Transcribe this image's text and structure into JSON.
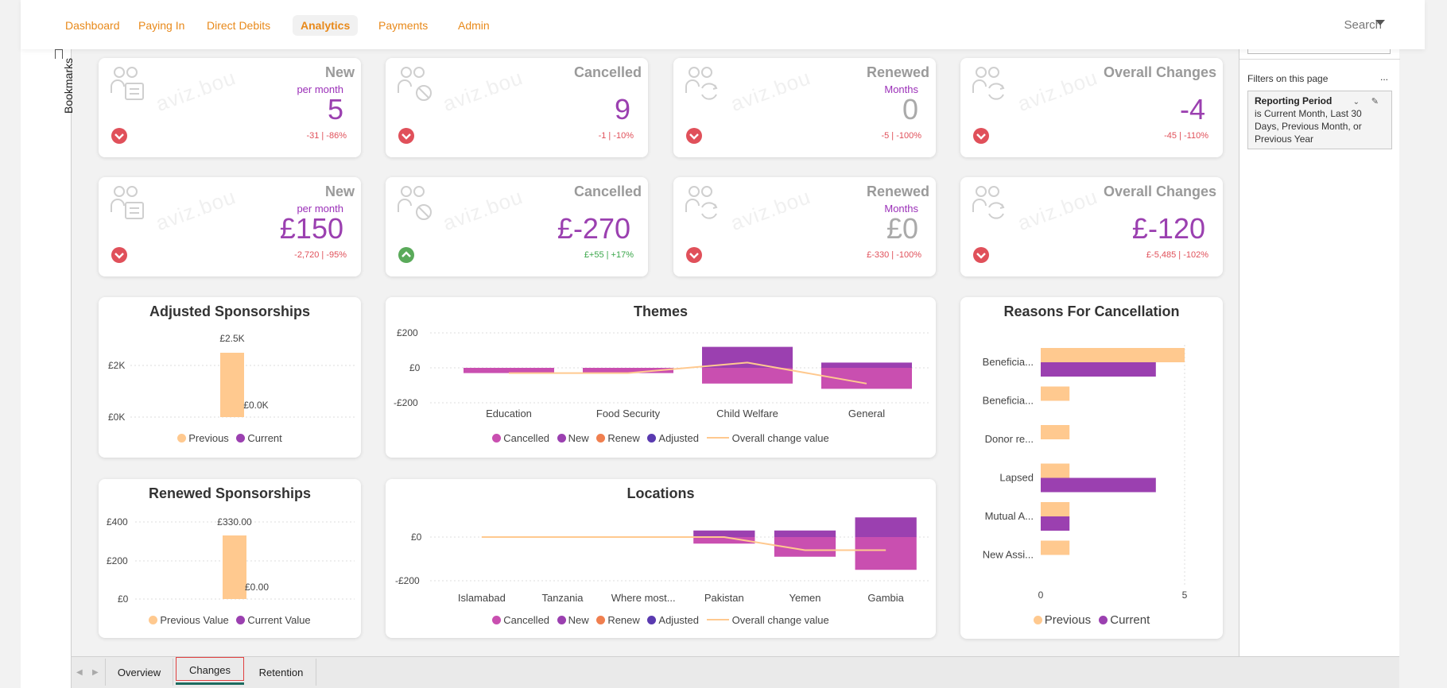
{
  "nav": {
    "items": [
      "Dashboard",
      "Paying In",
      "Direct Debits",
      "Analytics",
      "Payments",
      "Admin"
    ],
    "active": "Analytics",
    "search_label": "Search"
  },
  "bookmarks": {
    "label": "Bookmarks"
  },
  "filters": {
    "title": "Filters on this page",
    "more": "...",
    "card_title": "Reporting Period",
    "card_desc": "is Current Month, Last 30 Days, Previous Month, or Previous Year"
  },
  "kpi_row1": [
    {
      "title": "New",
      "sub": "per month",
      "value": "5",
      "delta": "-31  |  -86%",
      "trend": "down"
    },
    {
      "title": "Cancelled",
      "sub": "",
      "value": "9",
      "delta": "-1  |  -10%",
      "trend": "down"
    },
    {
      "title": "Renewed",
      "sub": "Months",
      "value": "0",
      "delta": "-5  |  -100%",
      "trend": "down",
      "grey": true
    },
    {
      "title": "Overall Changes",
      "sub": "",
      "value": "-4",
      "delta": "-45  |  -110%",
      "trend": "down"
    }
  ],
  "kpi_row2": [
    {
      "title": "New",
      "sub": "per month",
      "value": "£150",
      "delta": "-2,720  |  -95%",
      "trend": "down"
    },
    {
      "title": "Cancelled",
      "sub": "",
      "value": "£-270",
      "delta": "£+55  |  +17%",
      "trend": "up"
    },
    {
      "title": "Renewed",
      "sub": "Months",
      "value": "£0",
      "delta": "£-330  |  -100%",
      "trend": "down",
      "grey": true
    },
    {
      "title": "Overall Changes",
      "sub": "",
      "value": "£-120",
      "delta": "£-5,485  |  -102%",
      "trend": "down"
    }
  ],
  "watermark": "aviz.bou",
  "colors": {
    "previous": "#ffc98f",
    "current": "#9b40b0",
    "cancelled": "#c94fb0",
    "new": "#9b40b0",
    "renew": "#f07f4f",
    "adjusted": "#5a3ab0",
    "line": "#ffc98f",
    "down": "#e0505a",
    "up": "#5aaa5a"
  },
  "charts": {
    "adjusted": {
      "title": "Adjusted Sponsorships",
      "legend": [
        "Previous",
        "Current"
      ],
      "ticks": [
        "£2K",
        "£0K"
      ],
      "labels": [
        "£2.5K",
        "£0.0K"
      ]
    },
    "renewed": {
      "title": "Renewed Sponsorships",
      "legend": [
        "Previous Value",
        "Current Value"
      ],
      "ticks": [
        "£400",
        "£200",
        "£0"
      ],
      "labels": [
        "£330.00",
        "£0.00"
      ]
    },
    "themes": {
      "title": "Themes",
      "ticks": [
        "£200",
        "£0",
        "-£200"
      ],
      "categories": [
        "Education",
        "Food Security",
        "Child Welfare",
        "General"
      ],
      "legend": [
        "Cancelled",
        "New",
        "Renew",
        "Adjusted",
        "Overall change value"
      ]
    },
    "locations": {
      "title": "Locations",
      "ticks": [
        "£0",
        "-£200"
      ],
      "categories": [
        "Islamabad",
        "Tanzania",
        "Where most...",
        "Pakistan",
        "Yemen",
        "Gambia"
      ],
      "legend": [
        "Cancelled",
        "New",
        "Renew",
        "Adjusted",
        "Overall change value"
      ]
    },
    "reasons": {
      "title": "Reasons For Cancellation",
      "categories": [
        "Beneficia...",
        "Beneficia...",
        "Donor re...",
        "Lapsed",
        "Mutual A...",
        "New Assi..."
      ],
      "ticks": [
        "0",
        "5"
      ],
      "legend": [
        "Previous",
        "Current"
      ]
    }
  },
  "chart_data": [
    {
      "type": "bar",
      "title": "Adjusted Sponsorships",
      "categories": [
        "Previous",
        "Current"
      ],
      "values": [
        2500,
        0
      ],
      "data_labels": [
        "£2.5K",
        "£0.0K"
      ],
      "ylim": [
        0,
        2500
      ]
    },
    {
      "type": "bar",
      "title": "Renewed Sponsorships",
      "categories": [
        "Previous Value",
        "Current Value"
      ],
      "values": [
        330,
        0
      ],
      "data_labels": [
        "£330.00",
        "£0.00"
      ],
      "ylim": [
        0,
        400
      ]
    },
    {
      "type": "bar",
      "title": "Themes",
      "categories": [
        "Education",
        "Food Security",
        "Child Welfare",
        "General"
      ],
      "series": [
        {
          "name": "Cancelled",
          "values": [
            -30,
            -30,
            -90,
            -120
          ]
        },
        {
          "name": "New",
          "values": [
            0,
            0,
            120,
            30
          ]
        },
        {
          "name": "Renew",
          "values": [
            0,
            0,
            0,
            0
          ]
        },
        {
          "name": "Adjusted",
          "values": [
            0,
            0,
            0,
            0
          ]
        },
        {
          "name": "Overall change value",
          "values": [
            -30,
            -30,
            30,
            -90
          ]
        }
      ],
      "ylim": [
        -200,
        200
      ]
    },
    {
      "type": "bar",
      "title": "Locations",
      "categories": [
        "Islamabad",
        "Tanzania",
        "Where most...",
        "Pakistan",
        "Yemen",
        "Gambia"
      ],
      "series": [
        {
          "name": "Cancelled",
          "values": [
            0,
            0,
            0,
            -30,
            -90,
            -150
          ]
        },
        {
          "name": "New",
          "values": [
            0,
            0,
            0,
            30,
            30,
            90
          ]
        },
        {
          "name": "Renew",
          "values": [
            0,
            0,
            0,
            0,
            0,
            0
          ]
        },
        {
          "name": "Adjusted",
          "values": [
            0,
            0,
            0,
            0,
            0,
            0
          ]
        },
        {
          "name": "Overall change value",
          "values": [
            0,
            0,
            0,
            0,
            -60,
            -60
          ]
        }
      ],
      "ylim": [
        -200,
        100
      ]
    },
    {
      "type": "bar",
      "title": "Reasons For Cancellation",
      "categories": [
        "Beneficia...",
        "Beneficia...",
        "Donor re...",
        "Lapsed",
        "Mutual A...",
        "New Assi..."
      ],
      "series": [
        {
          "name": "Previous",
          "values": [
            5,
            1,
            1,
            1,
            1,
            1
          ]
        },
        {
          "name": "Current",
          "values": [
            4,
            0,
            0,
            4,
            1,
            0
          ]
        }
      ],
      "xlim": [
        0,
        5
      ]
    }
  ],
  "tabs": [
    "Overview",
    "Changes",
    "Retention"
  ],
  "active_tab": "Changes"
}
